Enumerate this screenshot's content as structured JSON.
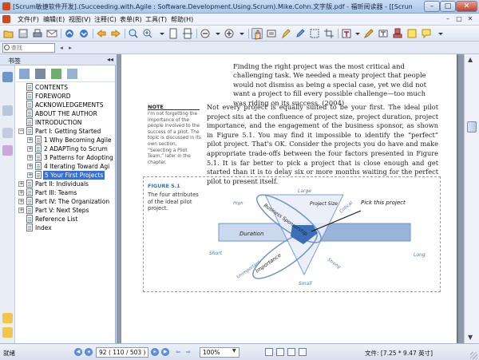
{
  "window": {
    "title": "[Scrum敏捷软件开发].(Succeeding.with.Agile : Software.Development.Using.Scrum).Mike.Cohn.文字版.pdf - 福昕阅读器 - [[Scrum敏捷软件开发].(Suc...",
    "minimize": "–",
    "maximize": "□",
    "close": "✕"
  },
  "menu": {
    "items": [
      "文件(F)",
      "编辑(E)",
      "视图(V)",
      "注释(C)",
      "表单(R)",
      "工具(T)",
      "帮助(H)"
    ],
    "mdi": [
      "–",
      "□",
      "✕"
    ]
  },
  "find": {
    "placeholder": "查找",
    "prev": "◂",
    "next": "▸"
  },
  "sidebar": {
    "title": "书签",
    "collapse": "◂◂",
    "tree": [
      {
        "label": "CONTENTS",
        "level": 0,
        "expander": ""
      },
      {
        "label": "FOREWORD",
        "level": 0,
        "expander": ""
      },
      {
        "label": "ACKNOWLEDGEMENTS",
        "level": 0,
        "expander": ""
      },
      {
        "label": "ABOUT THE AUTHOR",
        "level": 0,
        "expander": ""
      },
      {
        "label": "INTRODUCTION",
        "level": 0,
        "expander": ""
      },
      {
        "label": "Part I: Getting Started",
        "level": 0,
        "expander": "−"
      },
      {
        "label": "1 Why Becoming Agile",
        "level": 1,
        "expander": "+"
      },
      {
        "label": "2 ADAPTing to Scrum",
        "level": 1,
        "expander": "+"
      },
      {
        "label": "3 Patterns for Adopting",
        "level": 1,
        "expander": "+"
      },
      {
        "label": "4 Iterating Toward Agi",
        "level": 1,
        "expander": "+"
      },
      {
        "label": "5 Your First Projects",
        "level": 1,
        "expander": "+",
        "selected": true
      },
      {
        "label": "Part II: Individuals",
        "level": 0,
        "expander": "+"
      },
      {
        "label": "Part III: Teams",
        "level": 0,
        "expander": "+"
      },
      {
        "label": "Part IV: The Organization",
        "level": 0,
        "expander": "+"
      },
      {
        "label": "Part V: Next Steps",
        "level": 0,
        "expander": "+"
      },
      {
        "label": "Reference List",
        "level": 0,
        "expander": ""
      },
      {
        "label": "Index",
        "level": 0,
        "expander": ""
      }
    ]
  },
  "document": {
    "quote": "Finding the right project was the most critical and challenging task. We needed a meaty project that people would not dismiss as being a special case, yet we did not want a project to fill every possible challenge—too much was riding on its success. (2004)",
    "paragraph": "Not every project is equally suited to be your first. The ideal pilot project sits at the confluence of project size, project duration, project importance, and the engagement of the business sponsor, as shown in Figure 5.1. You may find it impossible to identify the “perfect” pilot project. That’s OK. Consider the projects you do have and make appropriate trade-offs between the four factors presented in Figure 5.1. It is far better to pick a project that is close enough and get started than it is to delay six or more months waiting for the perfect pilot to present itself.",
    "note": {
      "title": "NOTE",
      "body": "I'm not forgetting the importance of the people involved to the success of a pilot. The topic is discussed in its own section, “Selecting a Pilot Team,” later in the chapter."
    },
    "figure": {
      "label": "FIGURE 5.1",
      "caption": "The four attributes of the ideal pilot project.",
      "labels": {
        "large": "Large",
        "small": "Small",
        "short": "Short",
        "long": "Long",
        "duration": "Duration",
        "project_size": "Project Size",
        "importance": "Importance",
        "business_sponsorship": "Business Sponsorship",
        "high": "High",
        "unimportant": "Unimportant",
        "critical": "Critical",
        "strong": "Strong",
        "pick": "Pick this project"
      }
    }
  },
  "status": {
    "ready": "就绪",
    "page_value": "92",
    "page_of": "( 110 / 503 )",
    "zoom": "100%",
    "page_size": "文件: [7.25 * 9.47 英寸]"
  },
  "colors": {
    "accent": "#3a6fd0",
    "figure_blue": "#6f95c9",
    "figure_blue_light": "#cbd9ee"
  }
}
